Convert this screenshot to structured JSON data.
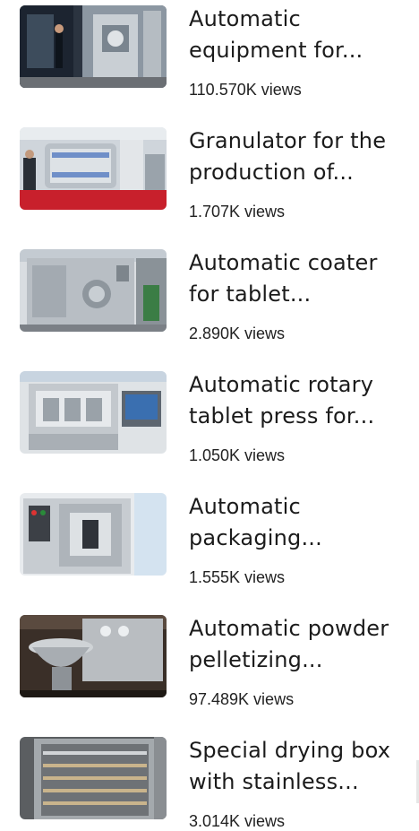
{
  "videos": [
    {
      "title": "Automatic equipment for...",
      "views": "110.570K views",
      "thumb": "tablet-press-exhibition"
    },
    {
      "title": "Granulator for the production of...",
      "views": "1.707K views",
      "thumb": "granulator-exhibition"
    },
    {
      "title": "Automatic coater for tablet...",
      "views": "2.890K views",
      "thumb": "coater-machine"
    },
    {
      "title": "Automatic rotary tablet press for...",
      "views": "1.050K views",
      "thumb": "rotary-tablet-press"
    },
    {
      "title": "Automatic packaging...",
      "views": "1.555K views",
      "thumb": "packaging-machine"
    },
    {
      "title": "Automatic powder pelletizing...",
      "views": "97.489K views",
      "thumb": "powder-pelletizer"
    },
    {
      "title": "Special drying box with stainless...",
      "views": "3.014K views",
      "thumb": "drying-box"
    }
  ]
}
